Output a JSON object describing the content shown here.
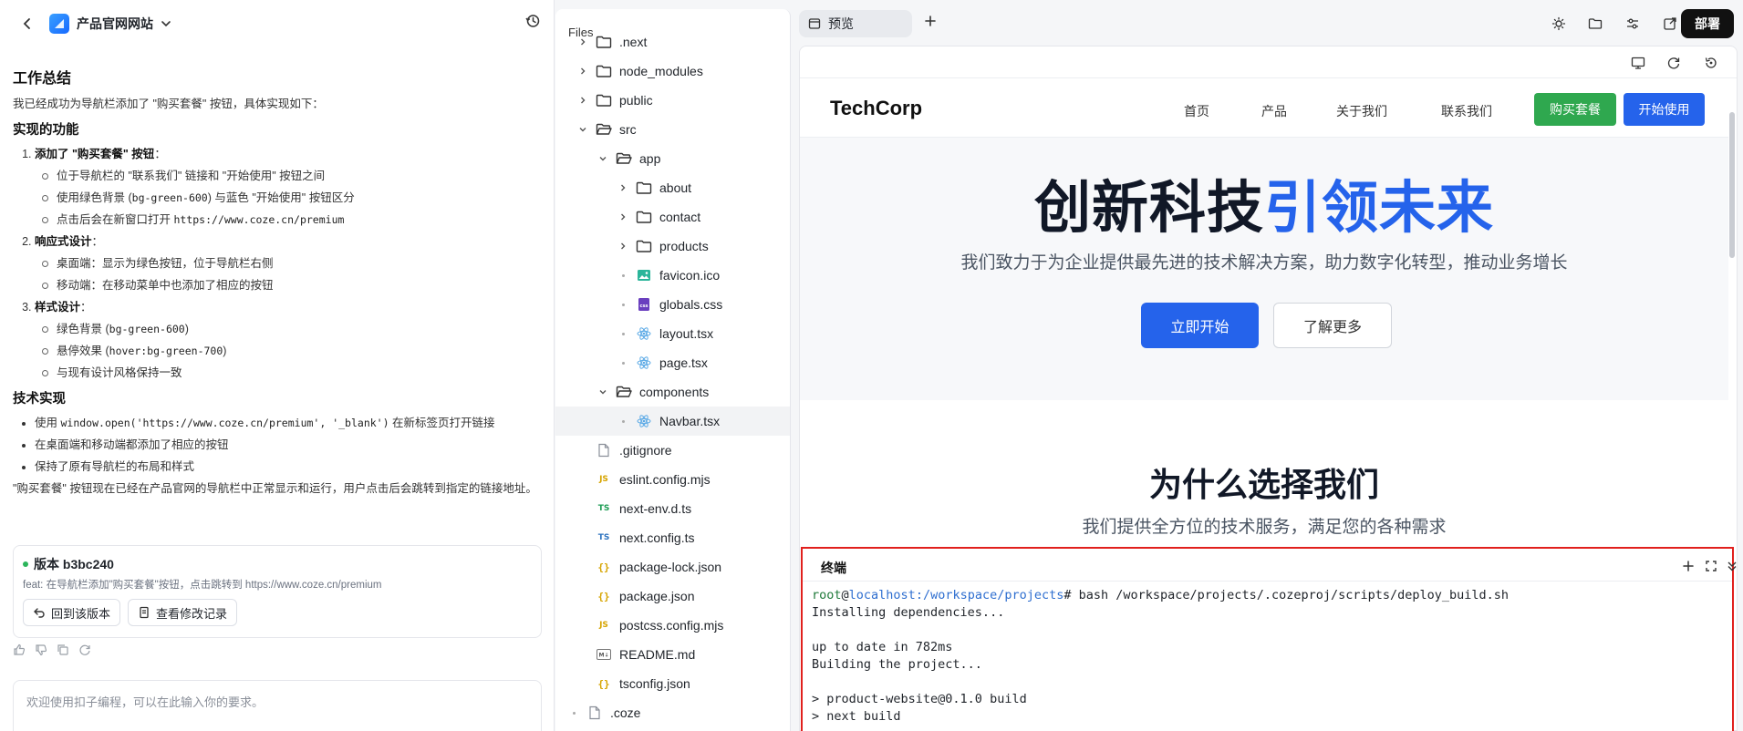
{
  "chat": {
    "header": {
      "title": "产品官网网站"
    },
    "summary_title": "工作总结",
    "intro": "我已经成功为导航栏添加了 \"购买套餐\" 按钮，具体实现如下：",
    "features_title": "实现的功能",
    "features": [
      {
        "title": "添加了 \"购买套餐\" 按钮",
        "items": [
          "位于导航栏的 \"联系我们\" 链接和 \"开始使用\" 按钮之间",
          "使用绿色背景 (bg-green-600) 与蓝色 \"开始使用\" 按钮区分",
          "点击后会在新窗口打开 https://www.coze.cn/premium"
        ]
      },
      {
        "title": "响应式设计",
        "items": [
          "桌面端：显示为绿色按钮，位于导航栏右侧",
          "移动端：在移动菜单中也添加了相应的按钮"
        ]
      },
      {
        "title": "样式设计",
        "items": [
          "绿色背景 (bg-green-600)",
          "悬停效果 (hover:bg-green-700)",
          "与现有设计风格保持一致"
        ]
      }
    ],
    "tech_title": "技术实现",
    "tech_items": [
      "使用 window.open('https://www.coze.cn/premium', '_blank') 在新标签页打开链接",
      "在桌面端和移动端都添加了相应的按钮",
      "保持了原有导航栏的布局和样式"
    ],
    "conclusion": "\"购买套餐\" 按钮现在已经在产品官网的导航栏中正常显示和运行，用户点击后会跳转到指定的链接地址。",
    "version": {
      "title": "版本 b3bc240",
      "desc": "feat: 在导航栏添加\"购买套餐\"按钮，点击跳转到 https://www.coze.cn/premium",
      "revert_label": "回到该版本",
      "changes_label": "查看修改记录"
    },
    "input_placeholder": "欢迎使用扣子编程，可以在此输入你的要求。"
  },
  "files": {
    "title": "Files",
    "rows": [
      {
        "name": ".next",
        "type": "folder",
        "depth": 1,
        "open": false,
        "arrow": true
      },
      {
        "name": "node_modules",
        "type": "folder",
        "depth": 1,
        "open": false,
        "arrow": true
      },
      {
        "name": "public",
        "type": "folder",
        "depth": 1,
        "open": false,
        "arrow": true
      },
      {
        "name": "src",
        "type": "folder",
        "depth": 1,
        "open": true,
        "arrow": true
      },
      {
        "name": "app",
        "type": "folder",
        "depth": 2,
        "open": true,
        "arrow": true
      },
      {
        "name": "about",
        "type": "folder",
        "depth": 3,
        "open": false,
        "arrow": true
      },
      {
        "name": "contact",
        "type": "folder",
        "depth": 3,
        "open": false,
        "arrow": true
      },
      {
        "name": "products",
        "type": "folder",
        "depth": 3,
        "open": false,
        "arrow": true
      },
      {
        "name": "favicon.ico",
        "type": "image",
        "depth": 3,
        "arrow": false
      },
      {
        "name": "globals.css",
        "type": "css",
        "depth": 3,
        "arrow": false
      },
      {
        "name": "layout.tsx",
        "type": "react",
        "depth": 3,
        "arrow": false
      },
      {
        "name": "page.tsx",
        "type": "react",
        "depth": 3,
        "arrow": false
      },
      {
        "name": "components",
        "type": "folder",
        "depth": 2,
        "open": true,
        "arrow": true
      },
      {
        "name": "Navbar.tsx",
        "type": "react",
        "depth": 3,
        "arrow": false,
        "selected": true
      },
      {
        "name": ".gitignore",
        "type": "file",
        "depth": 1,
        "arrow": false
      },
      {
        "name": "eslint.config.mjs",
        "type": "js",
        "depth": 1,
        "arrow": false
      },
      {
        "name": "next-env.d.ts",
        "type": "ts-green",
        "depth": 1,
        "arrow": false
      },
      {
        "name": "next.config.ts",
        "type": "ts",
        "depth": 1,
        "arrow": false
      },
      {
        "name": "package-lock.json",
        "type": "json",
        "depth": 1,
        "arrow": false
      },
      {
        "name": "package.json",
        "type": "json",
        "depth": 1,
        "arrow": false
      },
      {
        "name": "postcss.config.mjs",
        "type": "js",
        "depth": 1,
        "arrow": false
      },
      {
        "name": "README.md",
        "type": "md",
        "depth": 1,
        "arrow": false
      },
      {
        "name": "tsconfig.json",
        "type": "json",
        "depth": 1,
        "arrow": false
      },
      {
        "name": ".coze",
        "type": "file",
        "depth": 0,
        "arrow": false
      }
    ]
  },
  "topbar": {
    "tab_label": "预览",
    "deploy_label": "部署"
  },
  "site": {
    "brand": "TechCorp",
    "nav": [
      "首页",
      "产品",
      "关于我们",
      "联系我们"
    ],
    "buy_label": "购买套餐",
    "start_label": "开始使用",
    "hero_title_a": "创新科技",
    "hero_title_b": "引领未来",
    "hero_sub": "我们致力于为企业提供最先进的技术解决方案，助力数字化转型，推动业务增长",
    "hero_btn1": "立即开始",
    "hero_btn2": "了解更多",
    "why_title": "为什么选择我们",
    "why_sub": "我们提供全方位的技术服务，满足您的各种需求"
  },
  "terminal": {
    "title": "终端",
    "prompt_user": "root",
    "prompt_at": "@",
    "prompt_host": "localhost",
    "prompt_path": ":/workspace/projects",
    "prompt_cmd": "# bash /workspace/projects/.cozeproj/scripts/deploy_build.sh",
    "lines": [
      "Installing dependencies...",
      "",
      "up to date in 782ms",
      "Building the project...",
      "",
      "> product-website@0.1.0 build",
      "> next build"
    ]
  },
  "colors": {
    "brand_blue": "#2563eb",
    "buy_green": "#2fa84f",
    "terminal_border": "#e1201d"
  }
}
